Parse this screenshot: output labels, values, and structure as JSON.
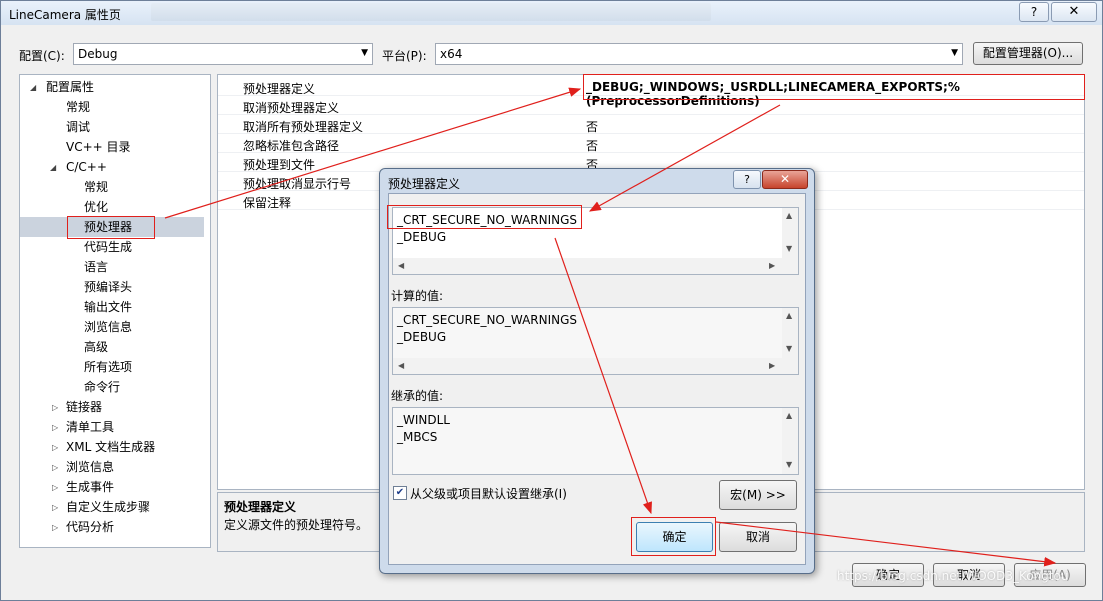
{
  "window": {
    "title": "LineCamera 属性页",
    "help": "?",
    "close": "✕"
  },
  "config": {
    "config_label": "配置(C):",
    "config_value": "Debug",
    "platform_label": "平台(P):",
    "platform_value": "x64",
    "manager_button": "配置管理器(O)..."
  },
  "tree": {
    "items": [
      {
        "label": "配置属性"
      },
      {
        "label": "常规"
      },
      {
        "label": "调试"
      },
      {
        "label": "VC++ 目录"
      },
      {
        "label": "C/C++"
      },
      {
        "label": "常规"
      },
      {
        "label": "优化"
      },
      {
        "label": "预处理器"
      },
      {
        "label": "代码生成"
      },
      {
        "label": "语言"
      },
      {
        "label": "预编译头"
      },
      {
        "label": "输出文件"
      },
      {
        "label": "浏览信息"
      },
      {
        "label": "高级"
      },
      {
        "label": "所有选项"
      },
      {
        "label": "命令行"
      },
      {
        "label": "链接器"
      },
      {
        "label": "清单工具"
      },
      {
        "label": "XML 文档生成器"
      },
      {
        "label": "浏览信息"
      },
      {
        "label": "生成事件"
      },
      {
        "label": "自定义生成步骤"
      },
      {
        "label": "代码分析"
      }
    ]
  },
  "grid": {
    "rows": [
      {
        "name": "预处理器定义",
        "value": "_DEBUG;_WINDOWS;_USRDLL;LINECAMERA_EXPORTS;%(PreprocessorDefinitions)"
      },
      {
        "name": "取消预处理器定义",
        "value": ""
      },
      {
        "name": "取消所有预处理器定义",
        "value": "否"
      },
      {
        "name": "忽略标准包含路径",
        "value": "否"
      },
      {
        "name": "预处理到文件",
        "value": "否"
      },
      {
        "name": "预处理取消显示行号",
        "value": "否"
      },
      {
        "name": "保留注释",
        "value": "否"
      }
    ]
  },
  "description": {
    "title": "预处理器定义",
    "text": "定义源文件的预处理符号。"
  },
  "dialog": {
    "title": "预处理器定义",
    "help": "?",
    "close": "✕",
    "defines": [
      "_CRT_SECURE_NO_WARNINGS",
      "_DEBUG"
    ],
    "computed_label": "计算的值:",
    "computed": [
      "_CRT_SECURE_NO_WARNINGS",
      "_DEBUG"
    ],
    "inherited_label": "继承的值:",
    "inherited": [
      "_WINDLL",
      "_MBCS"
    ],
    "inherit_checkbox": "从父级或项目默认设置继承(I)",
    "inherit_checked": true,
    "macro_button": "宏(M) >>",
    "ok_button": "确定",
    "cancel_button": "取消"
  },
  "bottom_buttons": {
    "ok": "确定",
    "cancel": "取消",
    "apply": "应用(A)"
  },
  "watermark": "https://blog.csdn.net/WOOD3_Kongtou",
  "colors": {
    "annotation_red": "#e0201c",
    "selection": "#cbd3de"
  }
}
